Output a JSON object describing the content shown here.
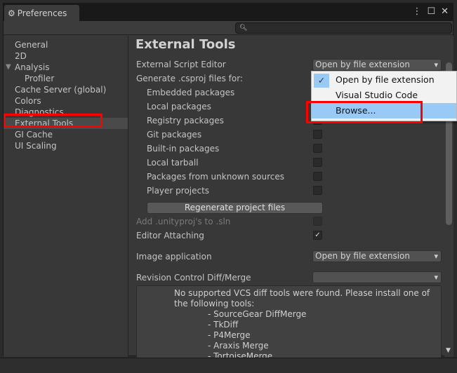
{
  "window": {
    "title": "Preferences",
    "icon": "gear-icon",
    "controls": [
      "more-icon",
      "maximize-icon",
      "close-icon"
    ]
  },
  "search": {
    "value": "",
    "icon": "search-icon"
  },
  "sidebar": {
    "items": [
      {
        "label": "General"
      },
      {
        "label": "2D"
      },
      {
        "label": "Analysis",
        "expanded": true
      },
      {
        "label": "Profiler",
        "child": true
      },
      {
        "label": "Cache Server (global)"
      },
      {
        "label": "Colors"
      },
      {
        "label": "Diagnostics"
      },
      {
        "label": "External Tools",
        "selected": true
      },
      {
        "label": "GI Cache"
      },
      {
        "label": "UI Scaling"
      }
    ]
  },
  "main": {
    "title": "External Tools",
    "script_editor_label": "External Script Editor",
    "script_editor_value": "Open by file extension",
    "generate_label": "Generate .csproj files for:",
    "packages": [
      {
        "label": "Embedded packages",
        "checked": false
      },
      {
        "label": "Local packages",
        "checked": false
      },
      {
        "label": "Registry packages",
        "checked": false
      },
      {
        "label": "Git packages",
        "checked": false
      },
      {
        "label": "Built-in packages",
        "checked": false
      },
      {
        "label": "Local tarball",
        "checked": false
      },
      {
        "label": "Packages from unknown sources",
        "checked": false
      },
      {
        "label": "Player projects",
        "checked": false
      }
    ],
    "regenerate_button": "Regenerate project files",
    "add_unityproj_label": "Add .unityproj's to .sln",
    "add_unityproj_checked": false,
    "editor_attaching_label": "Editor Attaching",
    "editor_attaching_checked": true,
    "image_app_label": "Image application",
    "image_app_value": "Open by file extension",
    "diff_label": "Revision Control Diff/Merge",
    "diff_value": "",
    "help_text": "No supported VCS diff tools were found. Please install one of the following tools:",
    "tools": [
      "- SourceGear DiffMerge",
      "- TkDiff",
      "- P4Merge",
      "- Araxis Merge",
      "- TortoiseMerge"
    ]
  },
  "dropdown_menu": {
    "items": [
      {
        "label": "Open by file extension",
        "checked": true
      },
      {
        "label": "Visual Studio Code"
      },
      {
        "label": "Browse...",
        "highlighted": true
      }
    ]
  },
  "colors": {
    "highlight_box": "#ff0000",
    "menu_highlight": "#99c9f5"
  }
}
